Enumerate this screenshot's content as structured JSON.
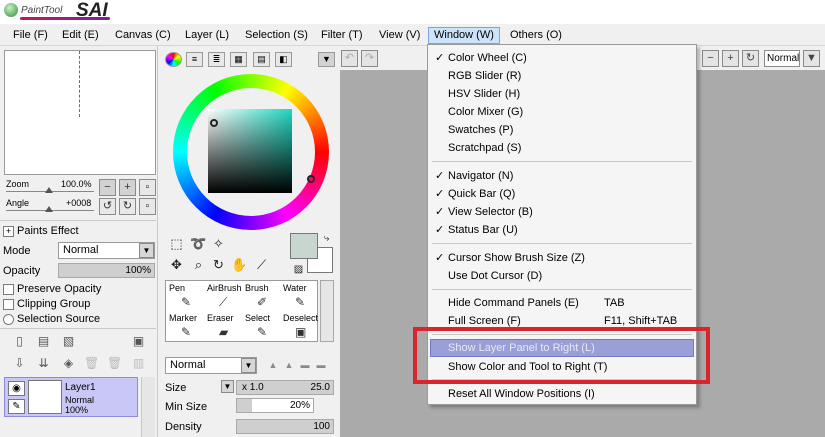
{
  "app": {
    "logo_small": "PaintTool",
    "logo_big": "SAI"
  },
  "menubar": [
    {
      "label": "File (F)"
    },
    {
      "label": "Edit (E)"
    },
    {
      "label": "Canvas (C)"
    },
    {
      "label": "Layer (L)"
    },
    {
      "label": "Selection (S)"
    },
    {
      "label": "Filter (T)"
    },
    {
      "label": "View (V)"
    },
    {
      "label": "Window (W)",
      "active": true
    },
    {
      "label": "Others (O)"
    }
  ],
  "navigator": {
    "zoom_label": "Zoom",
    "zoom_value": "100.0%",
    "angle_label": "Angle",
    "angle_value": "+0008"
  },
  "layer_props": {
    "paint_effect": "Paints Effect",
    "mode_label": "Mode",
    "mode_value": "Normal",
    "opacity_label": "Opacity",
    "opacity_value": "100%",
    "opacity_fraction": 1.0,
    "preserve_opacity": "Preserve Opacity",
    "clipping_group": "Clipping Group",
    "selection_source": "Selection Source"
  },
  "layer": {
    "name": "Layer1",
    "mode": "Normal",
    "opacity": "100%"
  },
  "brushes": [
    {
      "label": "Pen",
      "glyph": "✎"
    },
    {
      "label": "AirBrush",
      "glyph": "⟋"
    },
    {
      "label": "Brush",
      "glyph": "✐"
    },
    {
      "label": "Water",
      "glyph": "✎"
    },
    {
      "label": "Marker",
      "glyph": "✎"
    },
    {
      "label": "Eraser",
      "glyph": "▰"
    },
    {
      "label": "Select",
      "glyph": "✎"
    },
    {
      "label": "Deselect",
      "glyph": "▣"
    }
  ],
  "tool_options": {
    "blend_mode": "Normal",
    "size_label": "Size",
    "size_multiplier": "x 1.0",
    "size_value": "25.0",
    "min_size_label": "Min Size",
    "min_size_value": "20%",
    "min_size_fraction": 0.2,
    "density_label": "Density",
    "density_value": "100",
    "density_fraction": 1.0
  },
  "canvas_toolbar": {
    "blend_mode": "Normal"
  },
  "window_menu": {
    "items": [
      {
        "label": "Color Wheel (C)",
        "checked": true
      },
      {
        "label": "RGB Slider (R)",
        "checked": false
      },
      {
        "label": "HSV Slider (H)",
        "checked": false
      },
      {
        "label": "Color Mixer (G)",
        "checked": false
      },
      {
        "label": "Swatches (P)",
        "checked": false
      },
      {
        "label": "Scratchpad (S)",
        "checked": false
      },
      {
        "label": "Navigator (N)",
        "checked": true
      },
      {
        "label": "Quick Bar (Q)",
        "checked": true
      },
      {
        "label": "View Selector (B)",
        "checked": true
      },
      {
        "label": "Status Bar (U)",
        "checked": true
      },
      {
        "label": "Cursor Show Brush Size (Z)",
        "checked": true
      },
      {
        "label": "Use Dot Cursor (D)",
        "checked": false
      },
      {
        "label": "Hide Command Panels (E)",
        "shortcut": "TAB",
        "checked": false
      },
      {
        "label": "Full Screen (F)",
        "shortcut": "F11, Shift+TAB",
        "checked": false
      },
      {
        "label": "Show Layer Panel to Right (L)",
        "checked": false,
        "highlighted": true
      },
      {
        "label": "Show Color and Tool to Right (T)",
        "checked": false
      },
      {
        "label": "Reset All Window Positions (I)",
        "checked": false
      }
    ],
    "check_glyph": "✓"
  },
  "colors": {
    "highlight_box": "#d7262d",
    "menu_highlight": "#9a9fd8",
    "primary_color": "#c7d7d0",
    "secondary_color": "#ffffff",
    "layer_selected": "#c9c7f5"
  }
}
